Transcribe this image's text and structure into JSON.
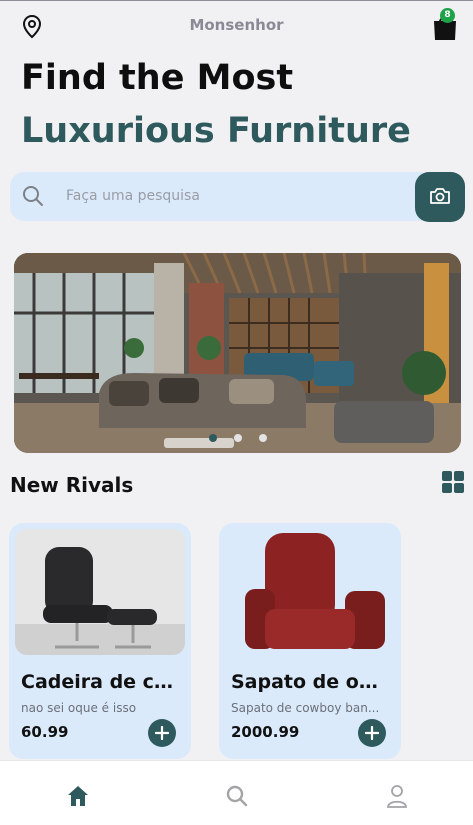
{
  "header": {
    "location": "Monsenhor",
    "cart_count": "8"
  },
  "hero": {
    "line1": "Find the Most",
    "line2": "Luxurious Furniture"
  },
  "search": {
    "placeholder": "Faça uma pesquisa"
  },
  "carousel": {
    "dot_count": 3,
    "active_dot": 0
  },
  "section": {
    "title": "New Rivals"
  },
  "products": [
    {
      "name": "Cadeira de co...",
      "description": "nao sei oque é isso",
      "price": "60.99"
    },
    {
      "name": "Sapato de ouro",
      "description": "Sapato de cowboy ban...",
      "price": "2000.99"
    }
  ],
  "nav": {
    "items": [
      "home-icon",
      "search-icon",
      "profile-icon"
    ],
    "active": "home-icon"
  },
  "colors": {
    "accent": "#2f5a5d",
    "card_bg": "#dbeafb",
    "badge": "#1fa34a",
    "page_bg": "#f1f1f3"
  }
}
